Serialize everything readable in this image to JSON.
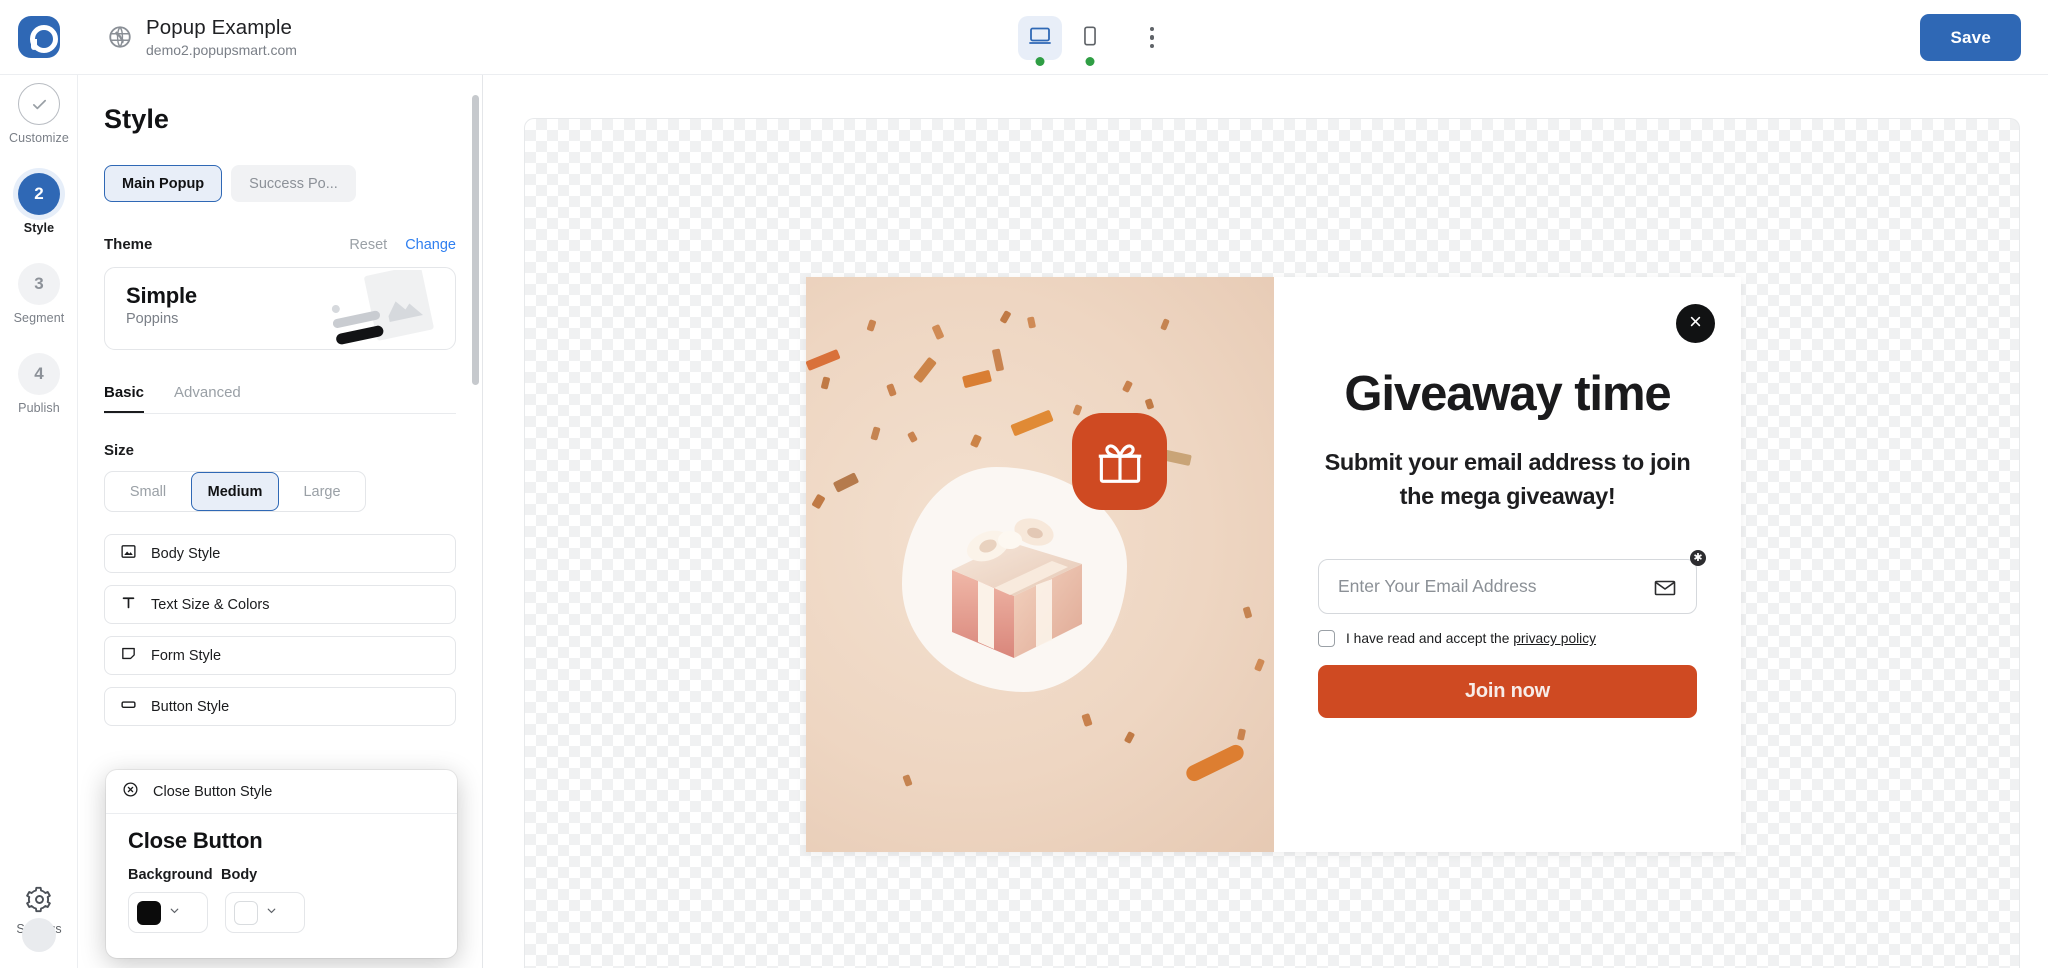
{
  "topbar": {
    "logo_icon": "popupsmart-logo-icon",
    "globe_icon": "globe-icon",
    "site_title": "Popup Example",
    "site_url": "demo2.popupsmart.com",
    "desktop_icon": "desktop-monitor-icon",
    "mobile_icon": "mobile-phone-icon",
    "kebab_icon": "more-vertical-icon",
    "desktop_status": "online",
    "mobile_status": "online",
    "save_label": "Save",
    "accent_blue": "#2f68b5",
    "status_green": "#2f9e44"
  },
  "rail": {
    "steps": [
      {
        "num": "✓",
        "label": "Customize",
        "state": "done"
      },
      {
        "num": "2",
        "label": "Style",
        "state": "current"
      },
      {
        "num": "3",
        "label": "Segment",
        "state": "todo"
      },
      {
        "num": "4",
        "label": "Publish",
        "state": "todo"
      }
    ],
    "settings_label": "Settings",
    "settings_icon": "gear-icon"
  },
  "panel": {
    "title": "Style",
    "popup_tabs": [
      {
        "label": "Main Popup",
        "active": true
      },
      {
        "label": "Success Po...",
        "active": false
      }
    ],
    "theme": {
      "section_label": "Theme",
      "reset_label": "Reset",
      "change_label": "Change",
      "name": "Simple",
      "font": "Poppins",
      "thumb_icon": "theme-preview-thumbnail"
    },
    "mode_tabs": [
      {
        "label": "Basic",
        "active": true
      },
      {
        "label": "Advanced",
        "active": false
      }
    ],
    "size": {
      "label": "Size",
      "options": [
        {
          "label": "Small",
          "selected": false
        },
        {
          "label": "Medium",
          "selected": true
        },
        {
          "label": "Large",
          "selected": false
        }
      ]
    },
    "accordions": [
      {
        "label": "Body Style",
        "icon": "image-frame-icon"
      },
      {
        "label": "Text Size & Colors",
        "icon": "text-t-icon"
      },
      {
        "label": "Form Style",
        "icon": "form-note-icon"
      },
      {
        "label": "Button Style",
        "icon": "button-rect-icon"
      }
    ]
  },
  "popover": {
    "header_label": "Close Button Style",
    "header_icon": "close-circle-icon",
    "heading": "Close Button",
    "fields": [
      {
        "label": "Background",
        "swatch": "#0b0b0b",
        "chevron": "chevron-down-icon"
      },
      {
        "label": "Body",
        "swatch": "#ffffff",
        "chevron": "chevron-down-icon"
      }
    ]
  },
  "preview": {
    "close_icon": "close-x-icon",
    "gift_badge_icon": "gift-box-icon",
    "gift_illustration_icon": "gift-box-3d-illustration",
    "heading": "Giveaway time",
    "subheading": "Submit your email address to join the mega giveaway!",
    "email_placeholder": "Enter Your Email Address",
    "email_value": "",
    "email_icon": "envelope-icon",
    "required_marker": "✱",
    "consent_text": "I have read and accept the",
    "consent_link": "privacy policy",
    "consent_checked": false,
    "submit_label": "Join now",
    "brand_orange": "#cf4a22",
    "visual_bg": "#eed6c2"
  }
}
